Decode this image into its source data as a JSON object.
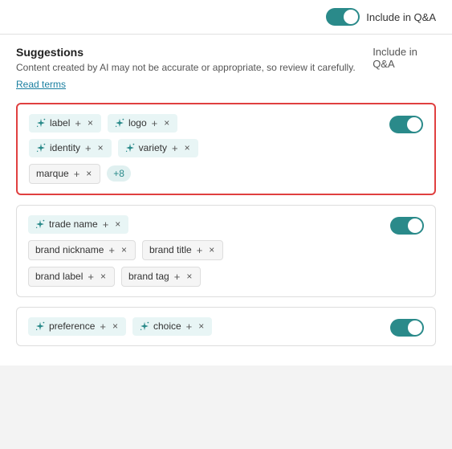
{
  "topbar": {
    "toggle_label": "Include in Q&A",
    "toggle_on": true
  },
  "suggestions": {
    "title": "Suggestions",
    "subtitle": "Content created by AI may not be accurate or appropriate, so review it carefully.",
    "read_terms": "Read terms",
    "include_label": "Include in Q&A"
  },
  "cards": [
    {
      "id": "card-1",
      "highlighted": true,
      "toggle_on": true,
      "rows": [
        [
          {
            "type": "ai",
            "text": "label",
            "has_plus": true,
            "has_close": true
          },
          {
            "type": "ai",
            "text": "logo",
            "has_plus": true,
            "has_close": true
          }
        ],
        [
          {
            "type": "ai",
            "text": "identity",
            "has_plus": true,
            "has_close": true
          },
          {
            "type": "ai",
            "text": "variety",
            "has_plus": true,
            "has_close": true
          }
        ],
        [
          {
            "type": "plain",
            "text": "marque",
            "has_plus": true,
            "has_close": true
          },
          {
            "type": "more",
            "text": "+8"
          }
        ]
      ]
    },
    {
      "id": "card-2",
      "highlighted": false,
      "toggle_on": true,
      "rows": [
        [
          {
            "type": "ai",
            "text": "trade name",
            "has_plus": true,
            "has_close": true
          }
        ],
        [
          {
            "type": "plain",
            "text": "brand nickname",
            "has_plus": true,
            "has_close": true
          },
          {
            "type": "plain",
            "text": "brand title",
            "has_plus": true,
            "has_close": true
          }
        ],
        [
          {
            "type": "plain",
            "text": "brand label",
            "has_plus": true,
            "has_close": true
          },
          {
            "type": "plain",
            "text": "brand tag",
            "has_plus": true,
            "has_close": true
          }
        ]
      ]
    },
    {
      "id": "card-3",
      "highlighted": false,
      "toggle_on": true,
      "rows": [
        [
          {
            "type": "ai",
            "text": "preference",
            "has_plus": true,
            "has_close": true
          },
          {
            "type": "ai",
            "text": "choice",
            "has_plus": true,
            "has_close": true
          }
        ]
      ]
    }
  ]
}
